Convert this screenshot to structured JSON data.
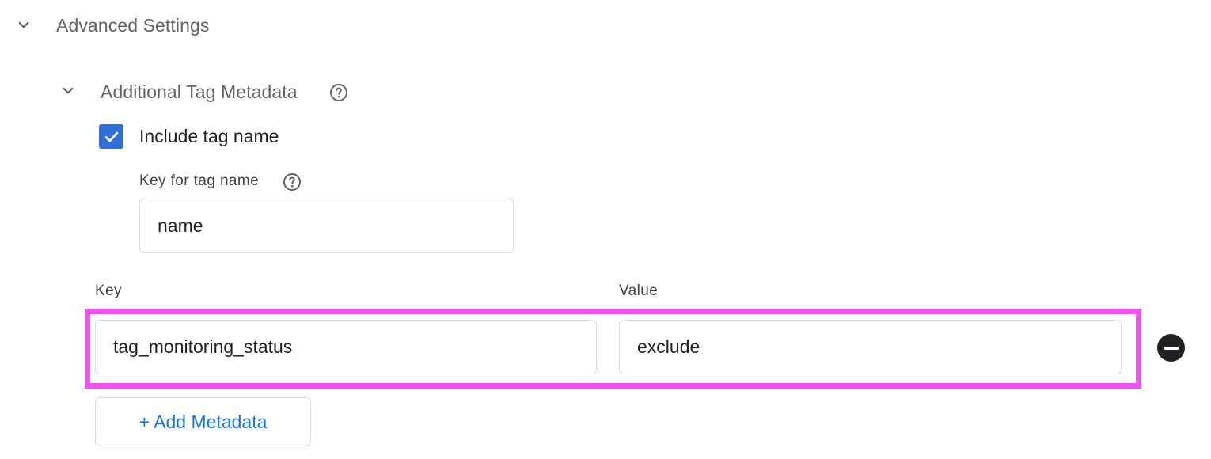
{
  "advanced_settings": {
    "title": "Advanced Settings",
    "expanded": true
  },
  "additional_tag_metadata": {
    "title": "Additional Tag Metadata",
    "expanded": true,
    "include_tag_name": {
      "label": "Include tag name",
      "checked": true
    },
    "key_for_tag_name": {
      "label": "Key for tag name",
      "value": "name"
    },
    "metadata_table": {
      "key_header": "Key",
      "value_header": "Value",
      "rows": [
        {
          "key": "tag_monitoring_status",
          "value": "exclude"
        }
      ]
    },
    "add_button_label": "+ Add Metadata"
  },
  "colors": {
    "checkbox": "#2f6fd8",
    "highlight": "#ee55ee",
    "link_blue": "#1a73e8"
  },
  "icons": {
    "chevron": "chevron-down-icon",
    "help": "help-circle-icon",
    "check": "check-icon",
    "remove": "remove-circle-icon"
  }
}
